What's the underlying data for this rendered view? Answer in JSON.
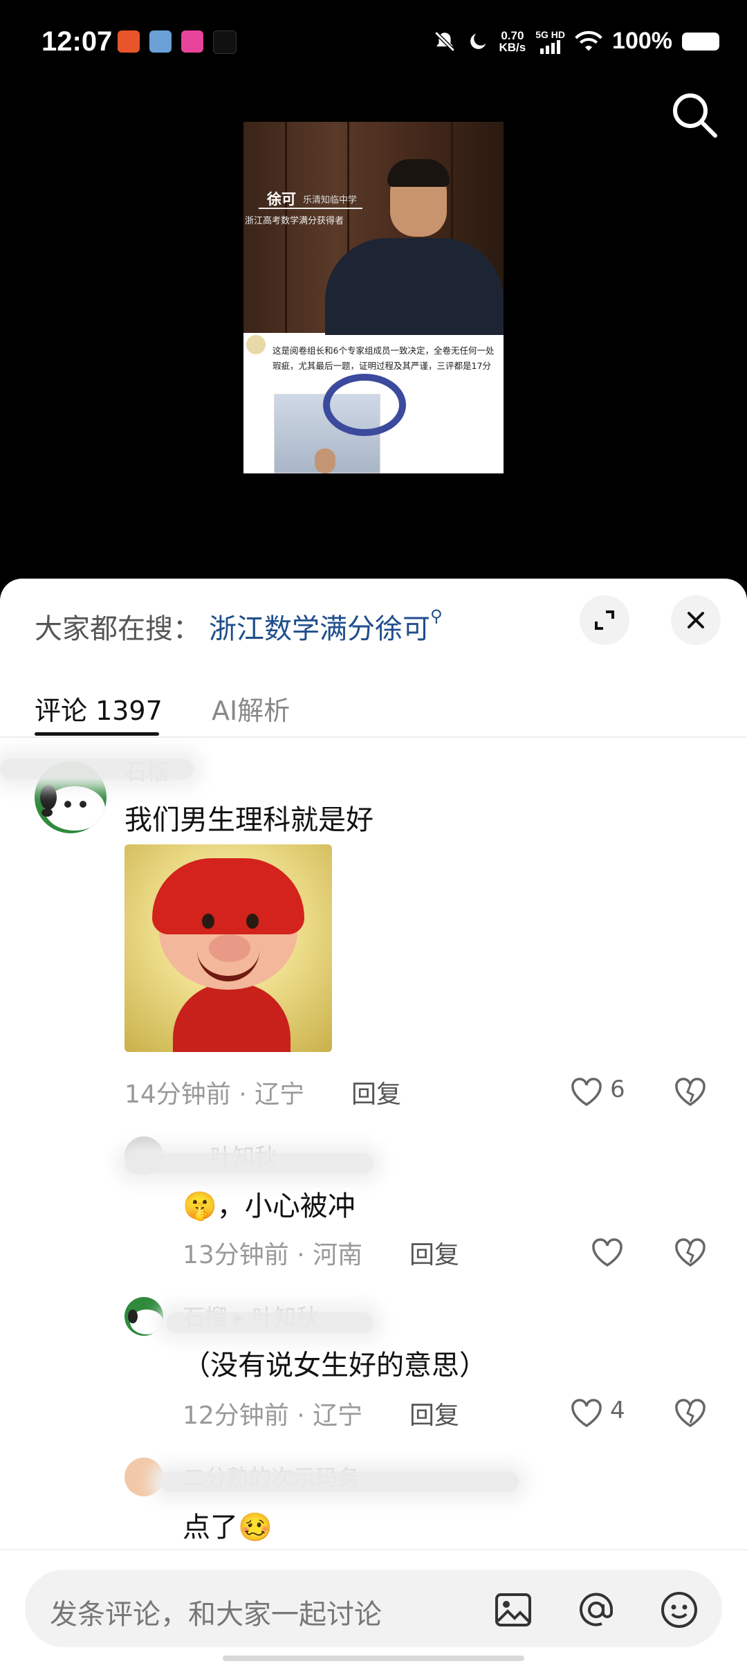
{
  "status_bar": {
    "time": "12:07",
    "net_speed_value": "0.70",
    "net_speed_unit": "KB/s",
    "network": "5G HD",
    "battery": "100%"
  },
  "video": {
    "name": "徐可",
    "school": "乐清知临中学",
    "subtitle": "浙江高考数学满分获得者",
    "post_text": "这是阅卷组长和6个专家组成员一致决定，全卷无任何一处瑕疵，尤其最后一题，证明过程及其严谨，三评都是17分"
  },
  "sheet": {
    "search_prefix": "大家都在搜：",
    "search_keyword": "浙江数学满分徐可",
    "tabs": [
      "评论",
      "1397",
      "AI解析"
    ],
    "tab_comments_label": "评论 1397",
    "tab_ai_label": "AI解析"
  },
  "comments": [
    {
      "username": "石榴",
      "text": "我们男生理科就是好",
      "time_location": "14分钟前 · 辽宁",
      "reply_label": "回复",
      "likes": "6"
    },
    {
      "username": "叶知秋",
      "text": "🤫，小心被冲",
      "time_location": "13分钟前 · 河南",
      "reply_label": "回复",
      "likes": ""
    },
    {
      "username": "石榴 ▸ 叶知秋",
      "text": "（没有说女生好的意思）",
      "time_location": "12分钟前 · 辽宁",
      "reply_label": "回复",
      "likes": "4"
    },
    {
      "username": "二分熟的次示玛务",
      "text": "点了🥴"
    }
  ],
  "input": {
    "placeholder": "发条评论，和大家一起讨论"
  },
  "colors": {
    "keyword": "#1f4e8c",
    "sheet_bg": "#ffffff",
    "screen_bg": "#000000"
  }
}
